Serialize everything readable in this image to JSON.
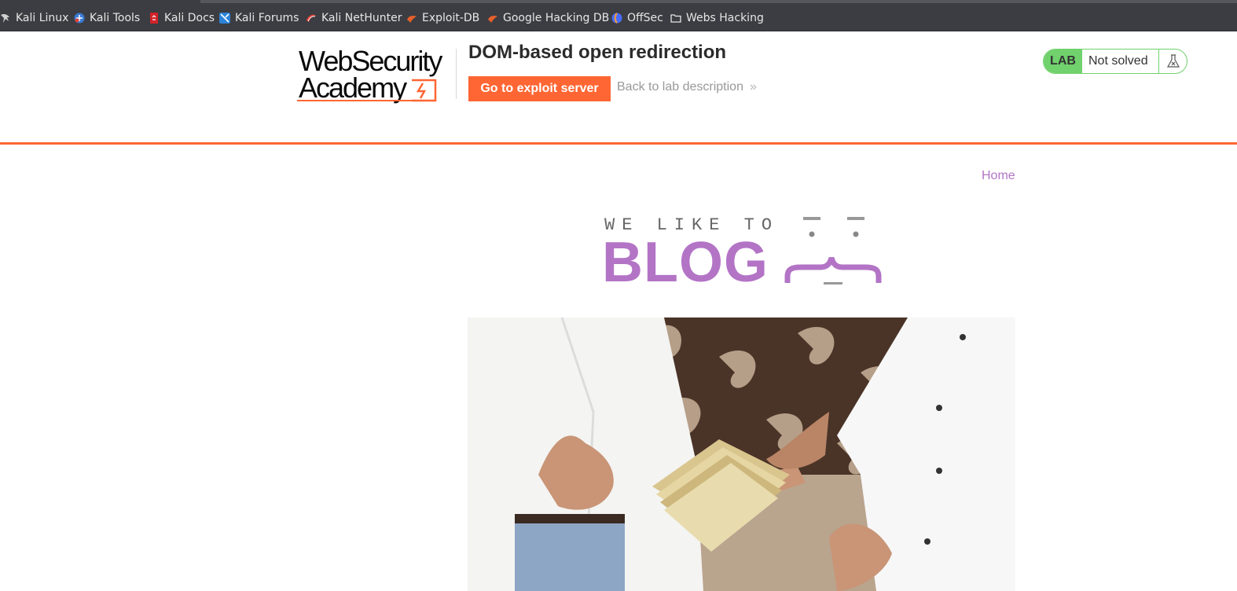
{
  "bookmarks": [
    {
      "label": "Kali Linux",
      "icon": "kali-dragon-icon",
      "color": "#d0d0d0"
    },
    {
      "label": "Kali Tools",
      "icon": "kali-tools-icon",
      "color": "#3a7bd5"
    },
    {
      "label": "Kali Docs",
      "icon": "kali-docs-icon",
      "color": "#d2232a"
    },
    {
      "label": "Kali Forums",
      "icon": "kali-forums-icon",
      "color": "#2c83d8"
    },
    {
      "label": "Kali NetHunter",
      "icon": "nethunter-icon",
      "color": "#e0403a"
    },
    {
      "label": "Exploit-DB",
      "icon": "exploit-db-icon",
      "color": "#e5602b"
    },
    {
      "label": "Google Hacking DB",
      "icon": "ghdb-icon",
      "color": "#e5602b"
    },
    {
      "label": "OffSec",
      "icon": "offsec-icon",
      "color": "#4a6cf7"
    },
    {
      "label": "Webs Hacking",
      "icon": "folder-icon",
      "color": "#e6e6e6"
    }
  ],
  "header": {
    "logo_line1": "WebSecurity",
    "logo_line2": "Academy",
    "lab_title": "DOM-based open redirection",
    "exploit_button": "Go to exploit server",
    "back_link": "Back to lab description",
    "back_chevrons": "»",
    "status_tag": "LAB",
    "status_text": "Not solved"
  },
  "nav": {
    "home": "Home"
  },
  "banner": {
    "tagline": "WE LIKE TO",
    "word": "BLOG"
  },
  "colors": {
    "accent_orange": "#ff6633",
    "blog_purple": "#b374c6",
    "lab_green": "#70d16d",
    "bookmark_bar": "#3b3d42"
  }
}
